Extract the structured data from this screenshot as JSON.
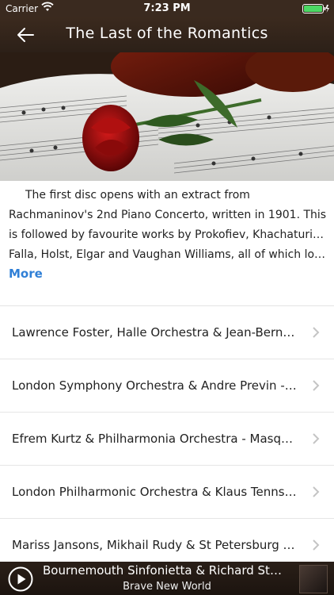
{
  "status": {
    "carrier": "Carrier",
    "time": "7:23 PM"
  },
  "nav": {
    "title": "The Last of the Romantics"
  },
  "description": {
    "line1": "The first disc opens with an extract from",
    "line2": "Rachmaninov's 2nd Piano Concerto, written in 1901. This",
    "line3": "is followed by favourite works by Prokofiev, Khachaturian,",
    "line4": "Falla, Holst, Elgar and Vaughan Williams, all of which loo...",
    "more_label": "More"
  },
  "tracks": [
    "Lawrence Foster, Halle Orchestra & Jean-Bernard Pommier",
    "London Symphony Orchestra & Andre Previn - Romeo and Juliet",
    "Efrem Kurtz & Philharmonia Orchestra - Masquerade Suite",
    "London Philharmonic Orchestra & Klaus Tennstedt - Planets",
    "Mariss Jansons, Mikhail Rudy & St Petersburg Philharmonic"
  ],
  "player": {
    "song": "Bournemouth Sinfonietta & Richard Studt",
    "album": "Brave New World"
  },
  "colors": {
    "accent": "#2f7fd6",
    "bar": "#3b2a1e"
  }
}
